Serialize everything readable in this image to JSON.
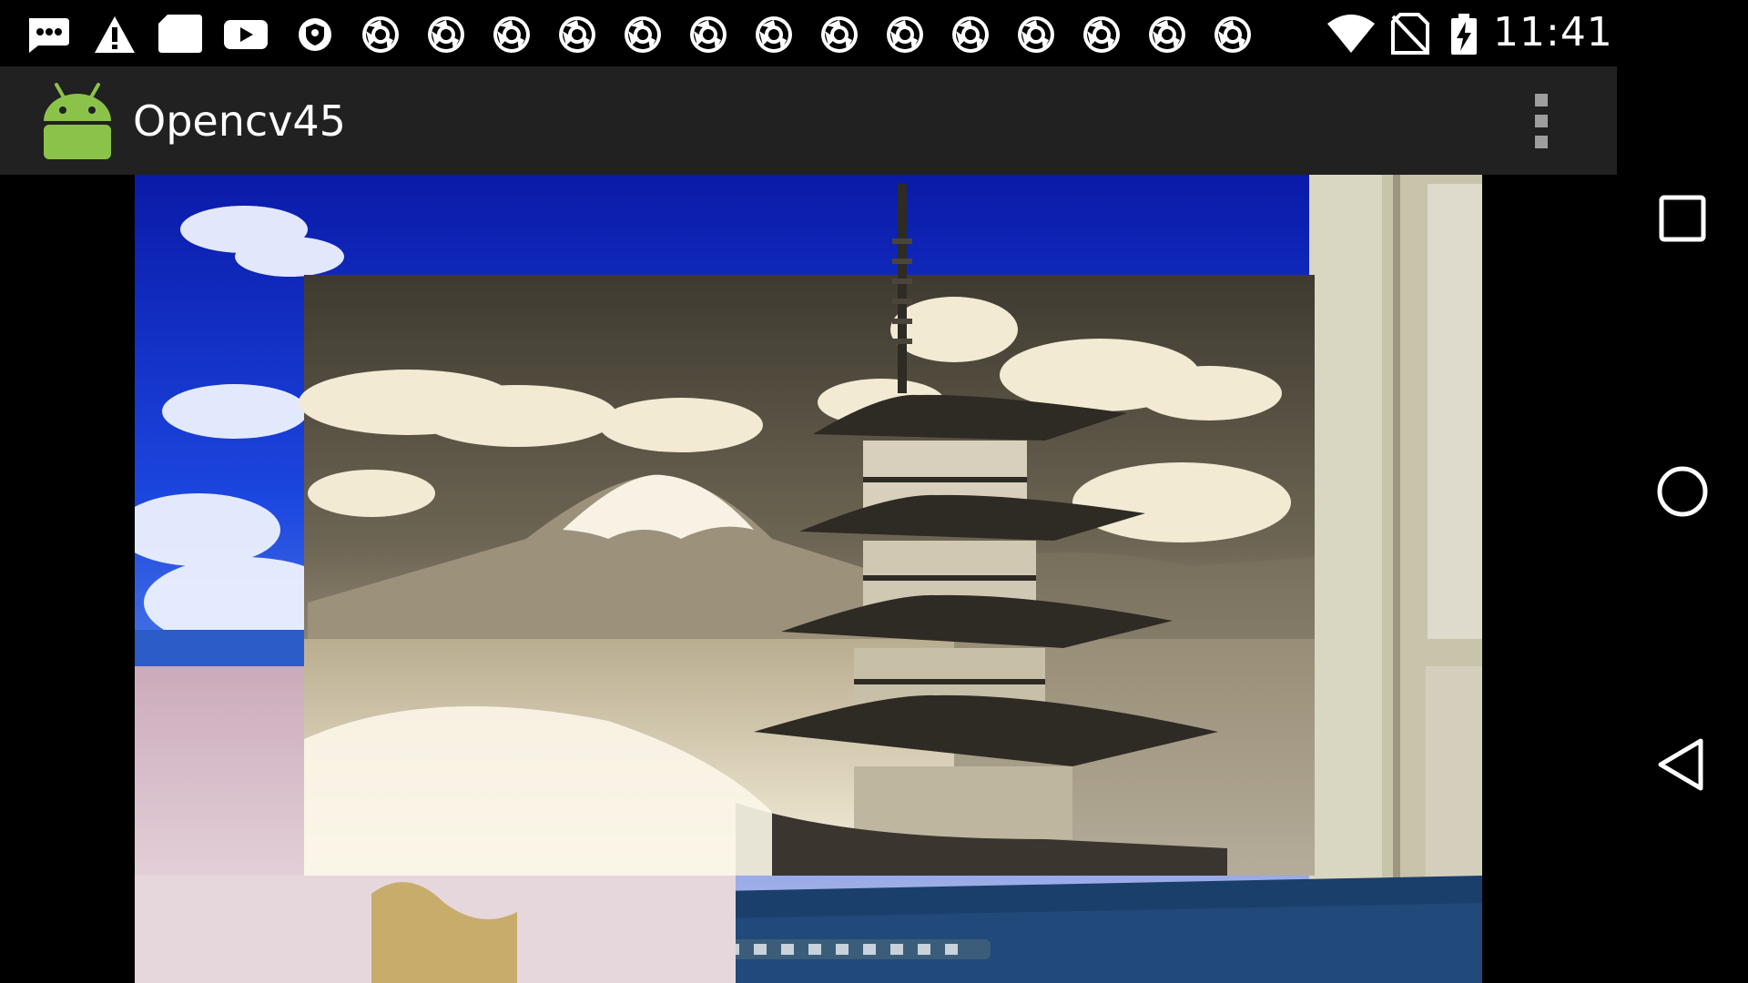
{
  "status_bar": {
    "time": "11:41",
    "notification_icons": [
      "sms-bubble-icon",
      "warning-icon",
      "sd-card-icon",
      "youtube-icon",
      "shield-icon",
      "chrome-icon",
      "chrome-icon",
      "chrome-icon",
      "chrome-icon",
      "chrome-icon",
      "chrome-icon",
      "chrome-icon",
      "chrome-icon",
      "chrome-icon",
      "chrome-icon",
      "chrome-icon",
      "chrome-icon",
      "chrome-icon",
      "chrome-icon"
    ],
    "system_icons": [
      "wifi-icon",
      "no-sim-icon",
      "battery-charging-icon"
    ]
  },
  "action_bar": {
    "title": "Opencv45",
    "app_icon": "android-robot-icon",
    "menu_icon": "overflow-menu-icon"
  },
  "preview": {
    "description_icon": "camera-preview",
    "processed_region": {
      "filter": "sepia-grayscale"
    }
  },
  "navigation_bar": {
    "buttons": [
      "recents-icon",
      "home-icon",
      "back-icon"
    ]
  },
  "colors": {
    "status_bar_bg": "#000000",
    "action_bar_bg": "#212121",
    "android_green": "#8BC34A",
    "sky_blue": "#1B3FD8"
  }
}
